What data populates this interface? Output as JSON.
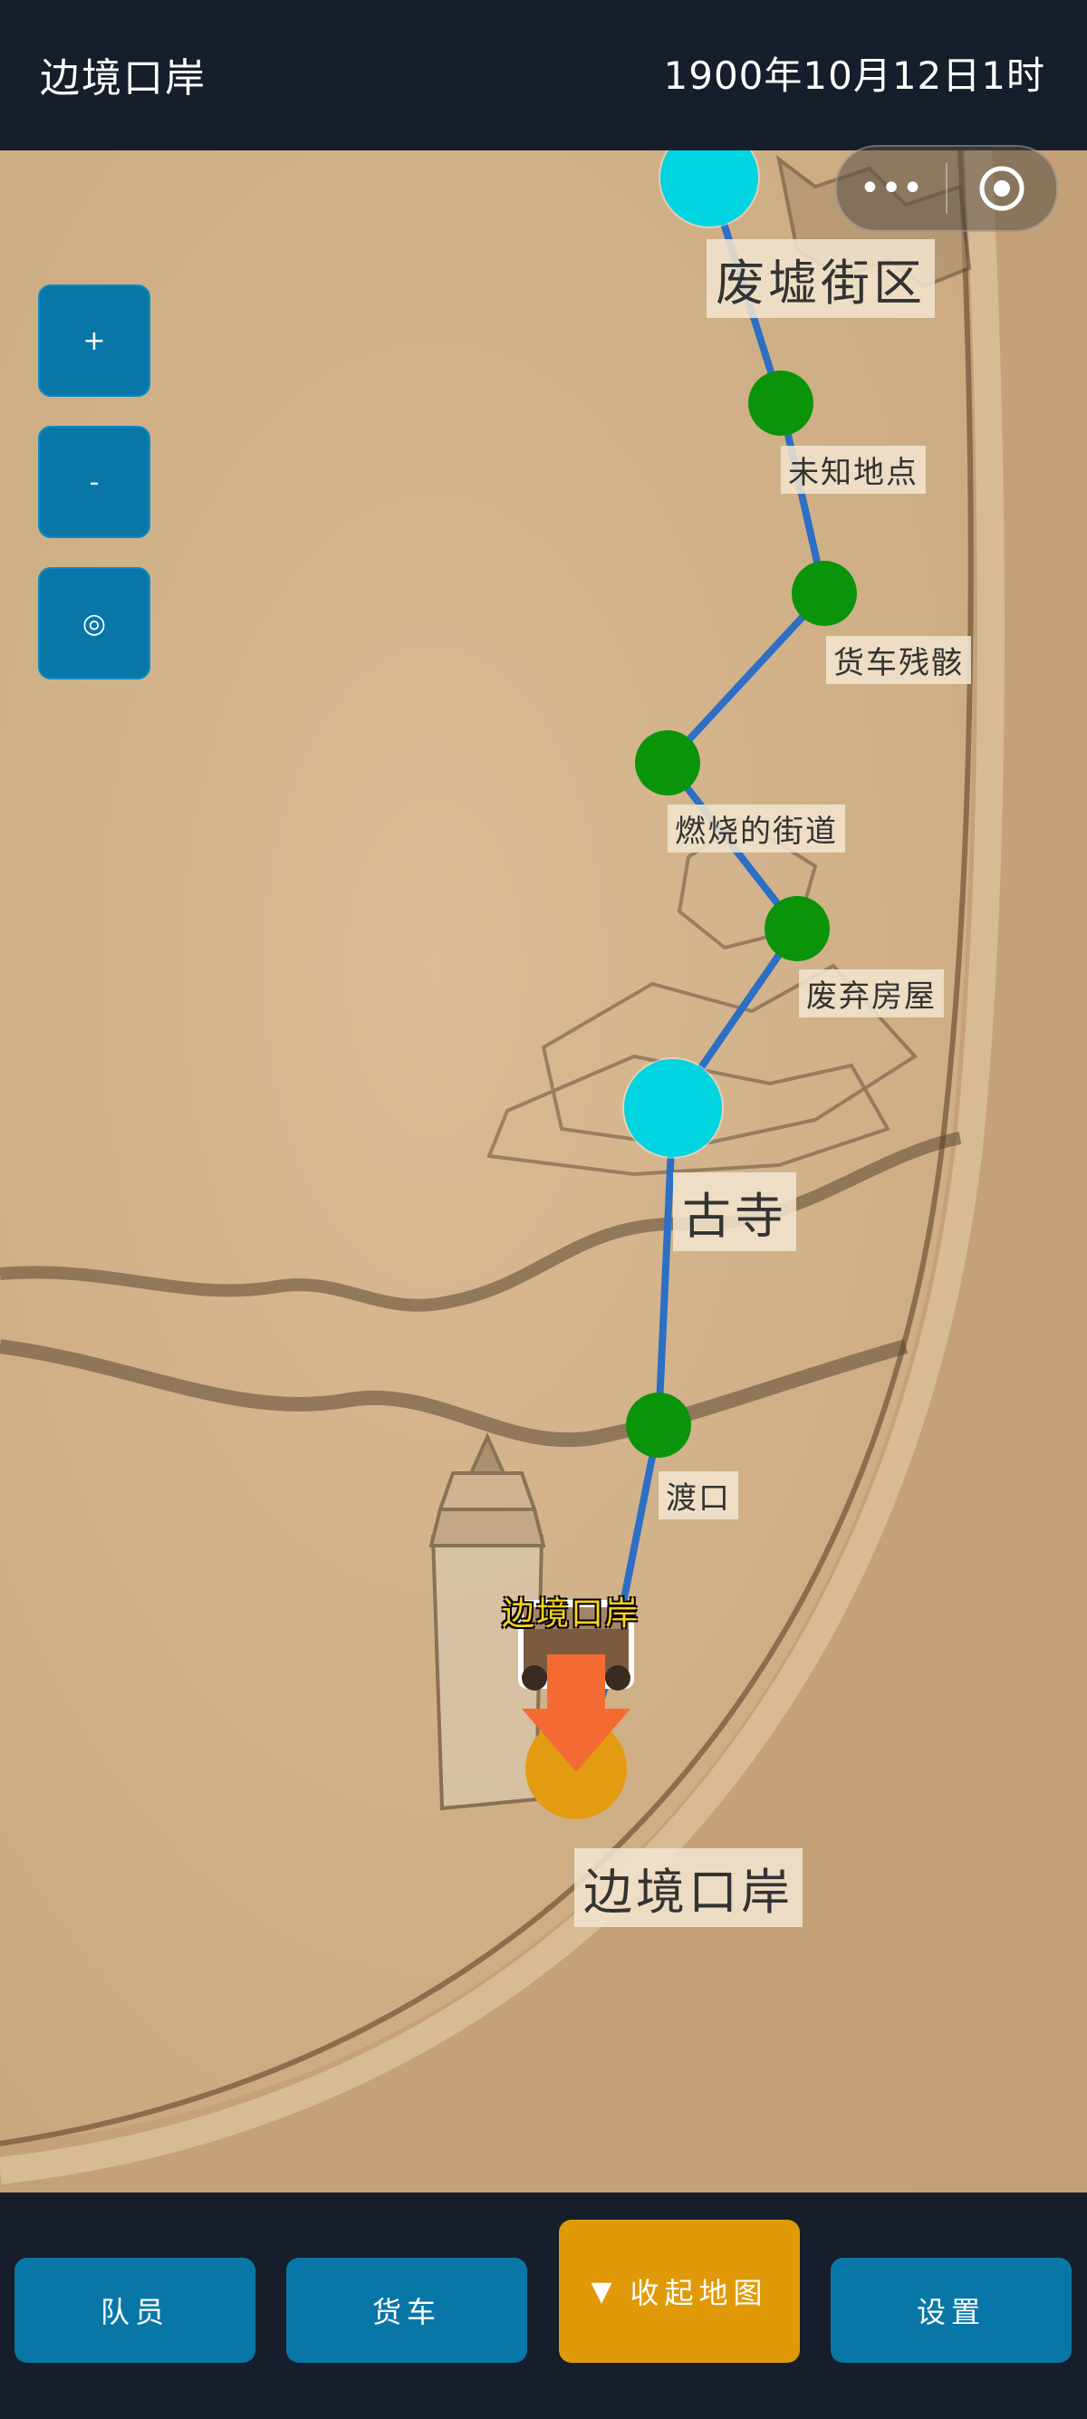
{
  "header": {
    "title": "边境口岸",
    "datetime": "1900年10月12日1时"
  },
  "controls": {
    "zoom_in": "+",
    "zoom_out": "-",
    "locate": "◎"
  },
  "capsule": {
    "more": "•••",
    "close_icon": "target-circle-icon"
  },
  "map": {
    "nodes": [
      {
        "name": "废墟街区",
        "type": "major",
        "color": "#00d4e0"
      },
      {
        "name": "未知地点",
        "type": "minor",
        "color": "#0a940a"
      },
      {
        "name": "货车残骸",
        "type": "minor",
        "color": "#0a940a"
      },
      {
        "name": "燃烧的街道",
        "type": "minor",
        "color": "#0a940a"
      },
      {
        "name": "废弃房屋",
        "type": "minor",
        "color": "#0a940a"
      },
      {
        "name": "古寺",
        "type": "major",
        "color": "#00d4e0"
      },
      {
        "name": "渡口",
        "type": "minor",
        "color": "#0a940a"
      },
      {
        "name": "边境口岸",
        "type": "current",
        "color": "#e39c12"
      }
    ],
    "player_label": "边境口岸",
    "route_color": "#2c6fc4"
  },
  "footer": {
    "team": "队员",
    "wagon": "货车",
    "collapse_map": "收起地图",
    "collapse_icon": "▼",
    "settings": "设置"
  }
}
